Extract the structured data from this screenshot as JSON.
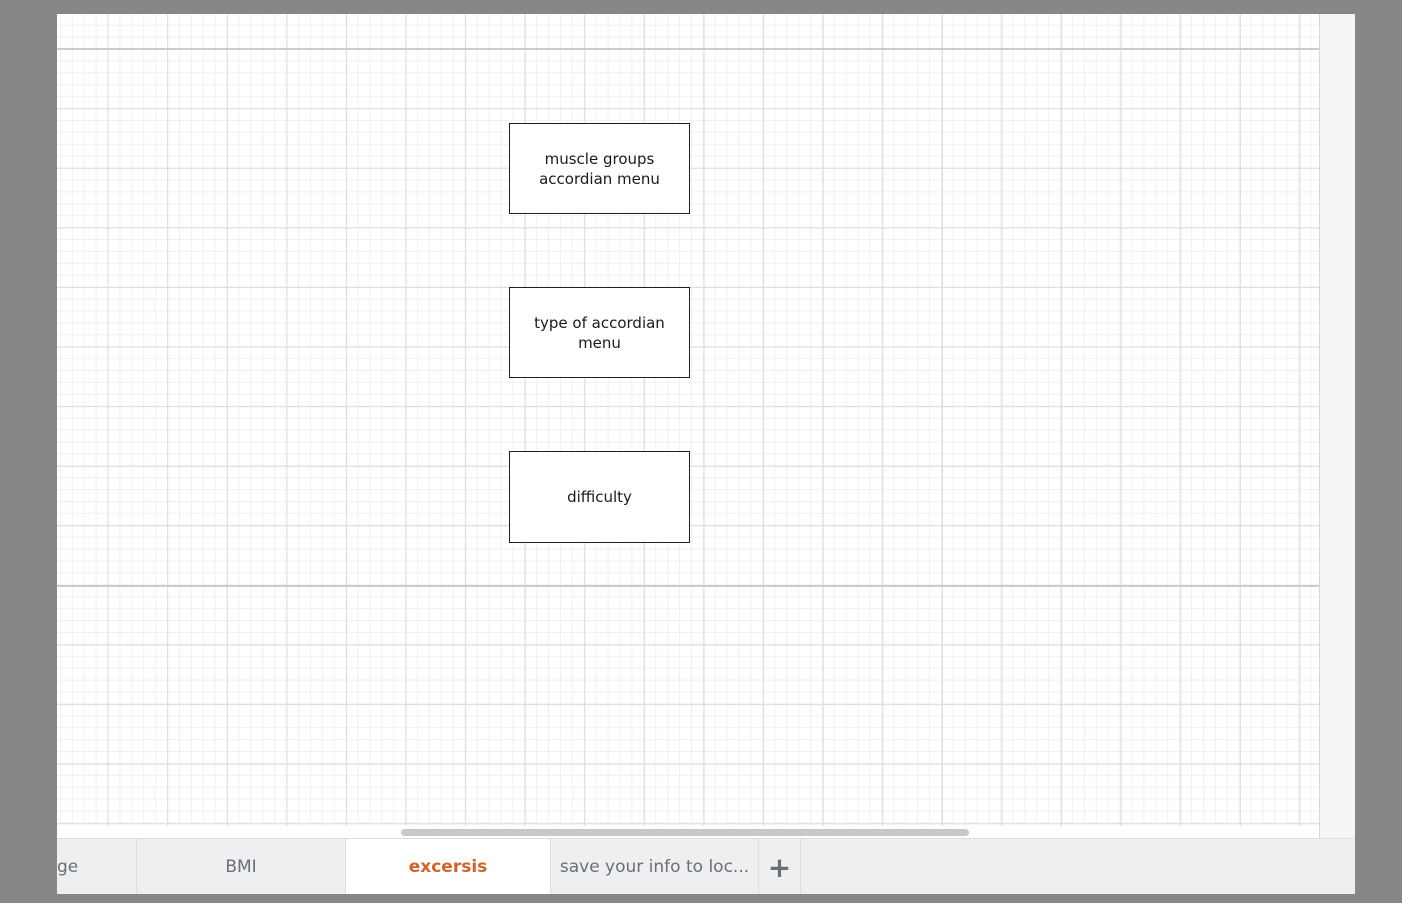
{
  "diagram": {
    "shapes": [
      {
        "text": "muscle groups\naccordian menu"
      },
      {
        "text": "type of  accordian\nmenu"
      },
      {
        "text": "difficulty"
      }
    ]
  },
  "tabs": [
    {
      "label": "ge",
      "active": false
    },
    {
      "label": "BMI",
      "active": false
    },
    {
      "label": "excersis",
      "active": true
    },
    {
      "label": "save your info to loc...",
      "active": false
    }
  ],
  "add_tab": {
    "label": "+"
  },
  "colors": {
    "active_tab_text": "#d2622a",
    "tab_text": "#6b6f73",
    "grid_major": "#d8dde2",
    "grid_minor": "#eef0f3"
  }
}
